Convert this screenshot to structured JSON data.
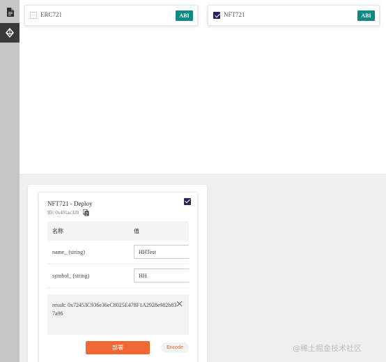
{
  "sidebar": {
    "items": [
      {
        "icon": "file-icon",
        "active": false
      },
      {
        "icon": "ethereum-icon",
        "active": true
      }
    ]
  },
  "contracts": [
    {
      "name": "ERC721",
      "checked": false,
      "abi_label": "ABI"
    },
    {
      "name": "NFT721",
      "checked": true,
      "abi_label": "ABI"
    }
  ],
  "deploy": {
    "title": "NFT721 - Deploy",
    "id_text": "ID: 0x401ac320",
    "checked": true,
    "table": {
      "header_name": "名称",
      "header_value": "值",
      "params": [
        {
          "label": "name_ (string)",
          "value": "HHTest"
        },
        {
          "label": "symbol_ (string)",
          "value": "HH"
        }
      ]
    },
    "result": "result: 0x72453C936e36eC8025E478F1A2928e982b837a96",
    "deploy_label": "部署",
    "encode_label": "Encode"
  },
  "colors": {
    "abi_bg": "#0e8a84",
    "checkbox": "#2b2160",
    "deploy_bg": "#f06935",
    "sidebar_bg": "#c6c6c6"
  },
  "watermark": "@稀土掘金技术社区"
}
